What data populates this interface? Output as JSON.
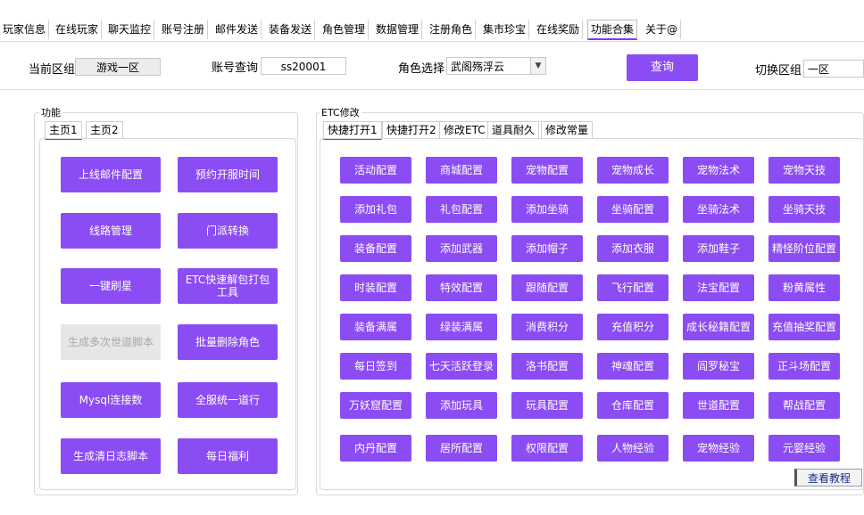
{
  "top_tabs": [
    "玩家信息",
    "在线玩家",
    "聊天监控",
    "账号注册",
    "邮件发送",
    "装备发送",
    "角色管理",
    "数据管理",
    "注册角色",
    "集市珍宝",
    "在线奖励",
    "功能合集",
    "关于@"
  ],
  "active_top_tab": "功能合集",
  "header": {
    "region_label": "当前区组",
    "region_value": "游戏一区",
    "account_label": "账号查询",
    "account_value": "ss20001",
    "role_label": "角色选择",
    "role_value": "武阁殇浮云",
    "query_button": "查询",
    "switch_label": "切换区组",
    "switch_value": "一区"
  },
  "left_group": {
    "title": "功能",
    "tabs": [
      "主页1",
      "主页2"
    ],
    "active_tab": "主页1",
    "buttons": [
      {
        "label": "上线邮件配置",
        "enabled": true
      },
      {
        "label": "预约开服时间",
        "enabled": true
      },
      {
        "label": "线路管理",
        "enabled": true
      },
      {
        "label": "门派转换",
        "enabled": true
      },
      {
        "label": "一键刷星",
        "enabled": true
      },
      {
        "label": "ETC快速解包打包工具",
        "enabled": true
      },
      {
        "label": "生成多次世道脚本",
        "enabled": false
      },
      {
        "label": "批量删除角色",
        "enabled": true
      },
      {
        "label": "Mysql连接数",
        "enabled": true
      },
      {
        "label": "全服统一道行",
        "enabled": true
      },
      {
        "label": "生成清日志脚本",
        "enabled": true
      },
      {
        "label": "每日福利",
        "enabled": true
      }
    ]
  },
  "right_group": {
    "title": "ETC修改",
    "tabs": [
      "快捷打开1",
      "快捷打开2",
      "修改ETC",
      "道具耐久",
      "修改常量"
    ],
    "active_tab": "快捷打开1",
    "buttons": [
      "活动配置",
      "商城配置",
      "宠物配置",
      "宠物成长",
      "宠物法术",
      "宠物天技",
      "添加礼包",
      "礼包配置",
      "添加坐骑",
      "坐骑配置",
      "坐骑法术",
      "坐骑天技",
      "装备配置",
      "添加武器",
      "添加帽子",
      "添加衣服",
      "添加鞋子",
      "精怪阶位配置",
      "时装配置",
      "特效配置",
      "跟随配置",
      "飞行配置",
      "法宝配置",
      "粉黄属性",
      "装备满属",
      "绿装满属",
      "消费积分",
      "充值积分",
      "成长秘籍配置",
      "充值抽奖配置",
      "每日签到",
      "七天活跃登录",
      "洛书配置",
      "神魂配置",
      "阎罗秘宝",
      "正斗场配置",
      "万妖窟配置",
      "添加玩具",
      "玩具配置",
      "仓库配置",
      "世道配置",
      "帮战配置",
      "内丹配置",
      "居所配置",
      "权限配置",
      "人物经验",
      "宠物经验",
      "元婴经验"
    ]
  },
  "tutorial_button": "查看教程",
  "colors": {
    "accent": "#8b4cf3",
    "tab_underline": "#7d3cf0",
    "disabled_bg": "#e6e6e9"
  }
}
